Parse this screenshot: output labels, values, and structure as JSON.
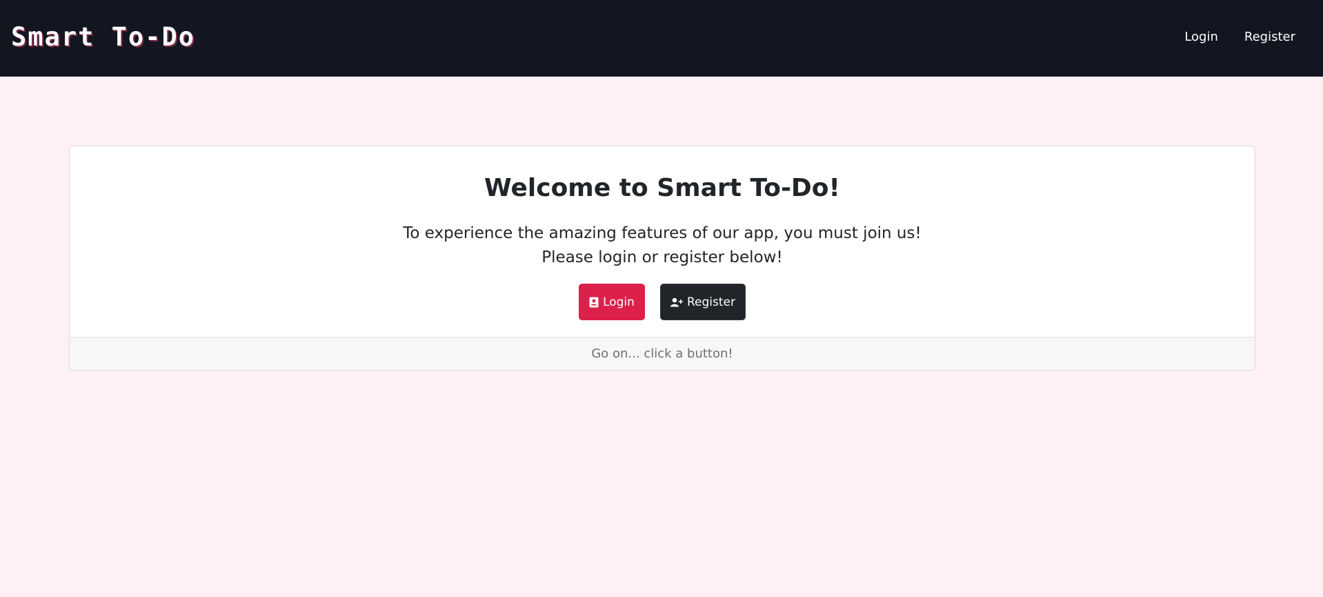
{
  "navbar": {
    "brand": "Smart To-Do",
    "links": [
      {
        "label": "Login"
      },
      {
        "label": "Register"
      }
    ]
  },
  "card": {
    "title": "Welcome to Smart To-Do!",
    "text_line1": "To experience the amazing features of our app, you must join us!",
    "text_line2": "Please login or register below!",
    "buttons": {
      "login": {
        "label": "Login",
        "icon": "address-card-icon",
        "color": "#dc1f4b"
      },
      "register": {
        "label": "Register",
        "icon": "user-plus-icon",
        "color": "#212529"
      }
    },
    "footer": "Go on... click a button!"
  },
  "colors": {
    "navbar_bg": "#131521",
    "page_bg": "#fff0f4",
    "accent": "#dc1f4b"
  }
}
